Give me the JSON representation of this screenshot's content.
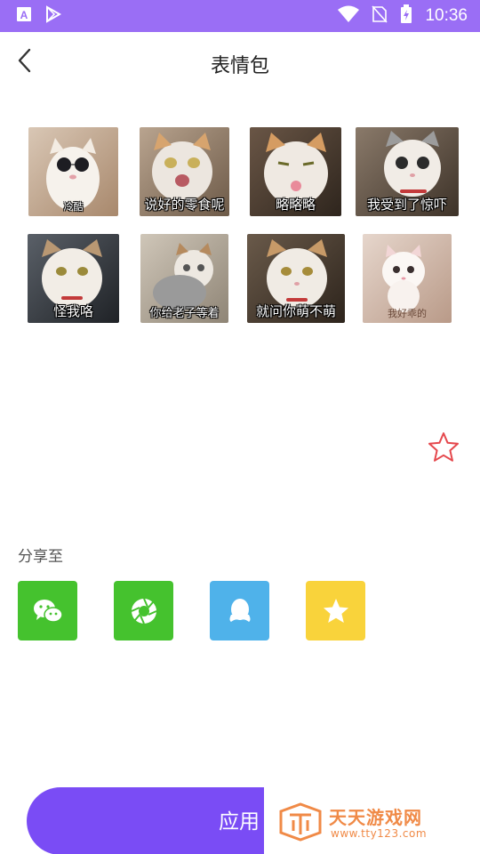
{
  "status_bar": {
    "time": "10:36"
  },
  "header": {
    "title": "表情包"
  },
  "stickers": [
    {
      "caption": "冷酷"
    },
    {
      "caption": "说好的零食呢"
    },
    {
      "caption": "略略略"
    },
    {
      "caption": "我受到了惊吓"
    },
    {
      "caption": "怪我咯"
    },
    {
      "caption": "你给老子等着"
    },
    {
      "caption": "就问你萌不萌"
    },
    {
      "caption": "我好乖的"
    }
  ],
  "share": {
    "label": "分享至",
    "targets": [
      {
        "icon": "wechat-icon",
        "color": "#45c22e"
      },
      {
        "icon": "moments-icon",
        "color": "#45c22e"
      },
      {
        "icon": "qq-icon",
        "color": "#4fb2ea"
      },
      {
        "icon": "favorite-star-icon",
        "color": "#f9d33b"
      }
    ]
  },
  "apply_button": {
    "label": "应用"
  },
  "watermark": {
    "title": "天天游戏网",
    "url": "www.tty123.com"
  },
  "colors": {
    "status_bar": "#9a6ef5",
    "accent": "#7a4cf5",
    "favorite_outline": "#e5484d"
  }
}
